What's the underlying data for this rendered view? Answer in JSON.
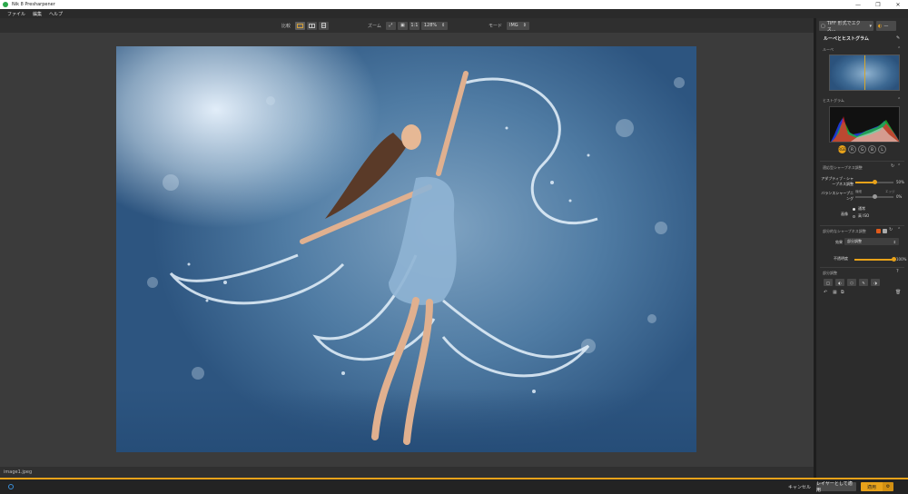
{
  "window": {
    "title": "Nik 8 Presharpener",
    "controls": [
      "—",
      "❐",
      "✕"
    ]
  },
  "menu": [
    "ファイル",
    "編集",
    "ヘルプ"
  ],
  "toolbar": {
    "compare_label": "比較",
    "zoom_label": "ズーム",
    "zoom_fit": "⤢",
    "zoom_fill": "▣",
    "zoom_1to1": "1:1",
    "zoom_value": "128%",
    "mode_label": "モード",
    "mode_value": "IMG",
    "stepper": "⇕"
  },
  "canvas": {
    "filename": "image1.jpeg"
  },
  "panel": {
    "export_select": "TIFF 形式でエクス...",
    "preset_value": "—",
    "title": "ルーペとヒストグラム",
    "loupe_label": "ルーペ",
    "histogram_label": "ヒストグラム",
    "channels": [
      "RGB",
      "R",
      "G",
      "B",
      "L"
    ],
    "adaptive_section": "適応型シャープネス調整",
    "adaptive_label": "アダプティブ・シャープネス調整",
    "adaptive_value": "50%",
    "adaptive_fraction": 0.5,
    "balance_label": "バランスシャープニング",
    "balance_left": "繊細",
    "balance_right": "エッジ",
    "balance_value": "0%",
    "balance_fraction": 0.5,
    "image_label": "画像",
    "image_options": [
      "通常",
      "高 ISO"
    ],
    "selective_section": "部分的なシャープネス調整",
    "effect_label": "効果",
    "effect_value": "部分調整",
    "opacity_label": "不透明度",
    "opacity_value": "100%",
    "opacity_fraction": 1.0,
    "local_label": "部分調整",
    "cancel": "キャンセル",
    "apply_layer": "レイヤーとして適用",
    "apply": "適用",
    "apply_options": "⚙"
  },
  "colors": {
    "accent": "#e8a21a",
    "panel": "#2c2c2c",
    "canvas": "#3b3b3b"
  }
}
